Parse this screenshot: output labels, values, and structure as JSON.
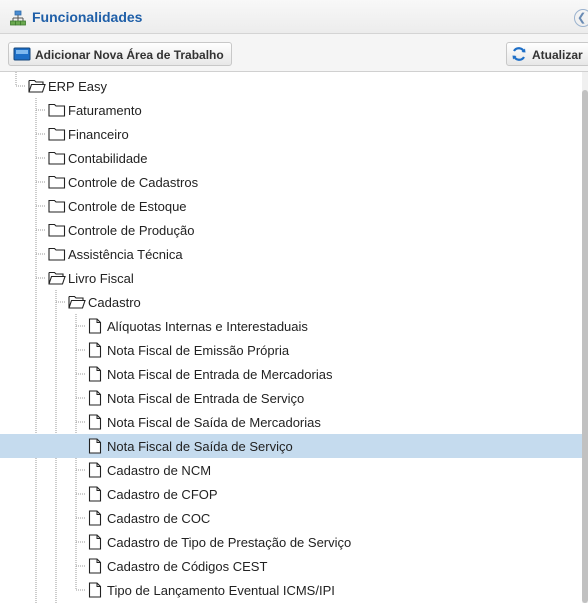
{
  "header": {
    "title": "Funcionalidades",
    "icon": "sitemap-icon"
  },
  "toolbar": {
    "add_workspace_label": "Adicionar Nova Área de Trabalho",
    "refresh_label": "Atualizar"
  },
  "tree": {
    "root": {
      "label": "ERP Easy",
      "expanded": true
    },
    "modules": [
      {
        "key": "faturamento",
        "label": "Faturamento"
      },
      {
        "key": "financeiro",
        "label": "Financeiro"
      },
      {
        "key": "contabilidade",
        "label": "Contabilidade"
      },
      {
        "key": "controle-de-cadastros",
        "label": "Controle de Cadastros"
      },
      {
        "key": "controle-de-estoque",
        "label": "Controle de Estoque"
      },
      {
        "key": "controle-de-producao",
        "label": "Controle de Produção"
      },
      {
        "key": "assistencia-tecnica",
        "label": "Assistência Técnica"
      },
      {
        "key": "livro-fiscal",
        "label": "Livro Fiscal",
        "expanded": true
      }
    ],
    "submodule": {
      "label": "Cadastro",
      "expanded": true
    },
    "items": [
      {
        "key": "aliquotas",
        "label": "Alíquotas Internas e Interestaduais"
      },
      {
        "key": "nf-emissao-propria",
        "label": "Nota Fiscal de Emissão Própria"
      },
      {
        "key": "nf-entrada-mercadorias",
        "label": "Nota Fiscal de Entrada de Mercadorias"
      },
      {
        "key": "nf-entrada-servico",
        "label": "Nota Fiscal de Entrada de Serviço"
      },
      {
        "key": "nf-saida-mercadorias",
        "label": "Nota Fiscal de Saída de Mercadorias"
      },
      {
        "key": "nf-saida-servico",
        "label": "Nota Fiscal de Saída de Serviço",
        "selected": true
      },
      {
        "key": "cadastro-ncm",
        "label": "Cadastro de NCM"
      },
      {
        "key": "cadastro-cfop",
        "label": "Cadastro de CFOP"
      },
      {
        "key": "cadastro-coc",
        "label": "Cadastro de COC"
      },
      {
        "key": "cadastro-tipo-prestacao",
        "label": "Cadastro de Tipo de Prestação de Serviço"
      },
      {
        "key": "cadastro-codigos-cest",
        "label": "Cadastro de Códigos CEST"
      },
      {
        "key": "tipo-lancamento-eventual",
        "label": "Tipo de Lançamento Eventual ICMS/IPI"
      }
    ]
  },
  "colors": {
    "title": "#1f5fa8",
    "selection": "#c5dbee",
    "tree_line": "#9a9a9a"
  }
}
